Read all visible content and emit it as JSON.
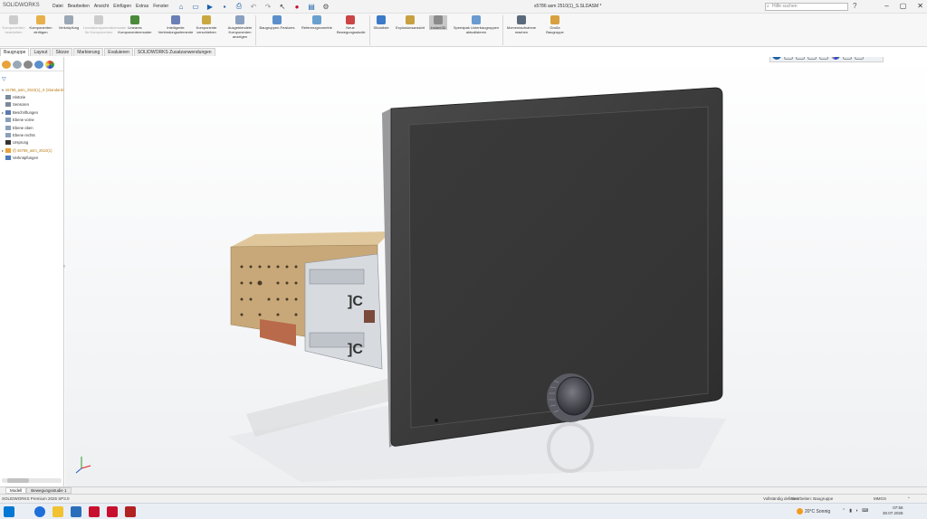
{
  "app": {
    "logo_brand": "SOLIDWORKS",
    "document_title": "s5786 asm 2510(1)_S.SLDASM *"
  },
  "menu": [
    "Datei",
    "Bearbeiten",
    "Ansicht",
    "Einfügen",
    "Extras",
    "Fenster"
  ],
  "search": {
    "placeholder": "Hilfe suchen"
  },
  "ribbon": [
    {
      "label": "Komponenten bearbeiten",
      "disabled": true
    },
    {
      "label": "Komponenten einfügen",
      "disabled": false
    },
    {
      "label": "Verknüpfung",
      "disabled": false
    },
    {
      "label": "Linearkomponentenmuster für Komponenten",
      "disabled": true
    },
    {
      "label": "Lineares Komponentenmuster",
      "disabled": false
    },
    {
      "label": "Intelligente Verbindungselemente",
      "disabled": false
    },
    {
      "label": "Komponente verschieben",
      "disabled": false
    },
    {
      "label": "Ausgeblendete Komponenten anzeigen",
      "disabled": false
    },
    {
      "label": "Baugruppen-Features",
      "disabled": false
    },
    {
      "label": "Referenzgeometrie",
      "disabled": false
    },
    {
      "label": "Neue Bewegungsstudie",
      "disabled": false
    },
    {
      "label": "Stückliste",
      "disabled": false
    },
    {
      "label": "Explosionsansicht",
      "disabled": false
    },
    {
      "label": "Instant3D",
      "disabled": false,
      "active": true
    },
    {
      "label": "Speedpak Unterbaugruppen aktualisieren",
      "disabled": false
    },
    {
      "label": "Momentaufnahme machen",
      "disabled": false
    },
    {
      "label": "Große Baugruppe",
      "disabled": false
    }
  ],
  "command_tabs": [
    "Baugruppe",
    "Layout",
    "Skizze",
    "Markierung",
    "Evaluieren",
    "SOLIDWORKS Zusatzanwendungen"
  ],
  "tree": [
    {
      "label": "s5786_asm_2510(1)_S (Standard<Anzeig",
      "icon": "assembly",
      "expand": "▾"
    },
    {
      "label": "Historie",
      "icon": "folder",
      "expand": ""
    },
    {
      "label": "Sensoren",
      "icon": "folder",
      "expand": ""
    },
    {
      "label": "Beschriftungen",
      "icon": "annot",
      "expand": "▸"
    },
    {
      "label": "Ebene vorne",
      "icon": "plane",
      "expand": ""
    },
    {
      "label": "Ebene oben",
      "icon": "plane",
      "expand": ""
    },
    {
      "label": "Ebene rechts",
      "icon": "plane",
      "expand": ""
    },
    {
      "label": "Ursprung",
      "icon": "origin",
      "expand": ""
    },
    {
      "label": "(f) s5786_asm_2510(1)",
      "icon": "assembly",
      "expand": "▸"
    },
    {
      "label": "Verknüpfungen",
      "icon": "mates",
      "expand": ""
    }
  ],
  "bottom_tabs": [
    "Modell",
    "Bewegungsstudie 1"
  ],
  "status": {
    "left": "SOLIDWORKS Premium 2025 SP3.0",
    "defined": "Vollständig definiert",
    "editing": "Bearbeiten: Baugruppe",
    "units": "MMGS"
  },
  "taskbar": {
    "weather": "20°C Sonnig",
    "time": "07:56",
    "date": "30.07.2026"
  },
  "colors": {
    "brand": "#c8102e",
    "accent": "#1a5fa8",
    "monitor_body": "#3a3a3a",
    "bracket": "#c8a878"
  }
}
